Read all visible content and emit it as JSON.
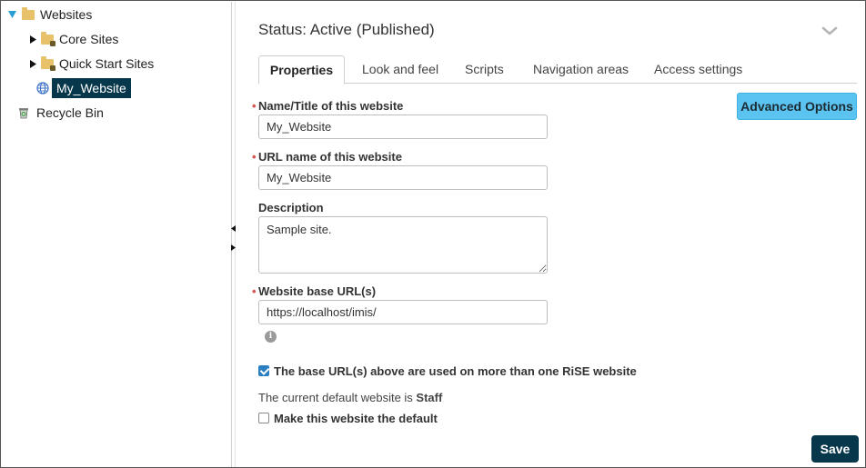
{
  "tree": {
    "items": [
      {
        "label": "Websites",
        "icon": "folder-icon",
        "expanded": true
      },
      {
        "label": "Core Sites",
        "icon": "locked-folder-icon",
        "expanded": false
      },
      {
        "label": "Quick Start Sites",
        "icon": "locked-folder-icon",
        "expanded": false
      },
      {
        "label": "My_Website",
        "icon": "globe-icon",
        "selected": true
      },
      {
        "label": "Recycle Bin",
        "icon": "recycle-bin-icon"
      }
    ]
  },
  "header": {
    "status": "Status: Active (Published)"
  },
  "tabs": [
    {
      "label": "Properties",
      "active": true
    },
    {
      "label": "Look and feel"
    },
    {
      "label": "Scripts"
    },
    {
      "label": "Navigation areas"
    },
    {
      "label": "Access settings"
    }
  ],
  "advanced_button": "Advanced Options",
  "form": {
    "name": {
      "label": "Name/Title of this website",
      "value": "My_Website",
      "required": true
    },
    "url_name": {
      "label": "URL name of this website",
      "value": "My_Website",
      "required": true
    },
    "description": {
      "label": "Description",
      "value": "Sample site."
    },
    "base_url": {
      "label": "Website base URL(s)",
      "value": "https://localhost/imis/",
      "required": true
    },
    "multi_site": {
      "label": "The base URL(s) above are used on more than one RiSE website",
      "checked": true
    },
    "default_note_prefix": "The current default website is ",
    "default_site_name": "Staff",
    "make_default": {
      "label": "Make this website the default",
      "checked": false
    }
  },
  "save_button": "Save",
  "colors": {
    "accent_dark": "#06374b",
    "advanced_button": "#5bc3f0",
    "required": "#d9534f"
  }
}
